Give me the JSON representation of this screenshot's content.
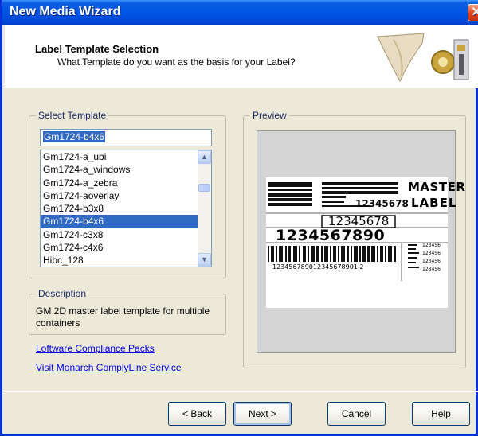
{
  "window": {
    "title": "New Media Wizard",
    "close_glyph": "✕"
  },
  "header": {
    "title": "Label Template Selection",
    "subtitle": "What Template do you want as the basis for your Label?"
  },
  "select_template": {
    "group_label": "Select Template",
    "input_value": "Gm1724-b4x6",
    "items": [
      {
        "label": "Gm1724-a_ubi",
        "selected": false
      },
      {
        "label": "Gm1724-a_windows",
        "selected": false
      },
      {
        "label": "Gm1724-a_zebra",
        "selected": false
      },
      {
        "label": "Gm1724-aoverlay",
        "selected": false
      },
      {
        "label": "Gm1724-b3x8",
        "selected": false
      },
      {
        "label": "Gm1724-b4x6",
        "selected": true
      },
      {
        "label": "Gm1724-c3x8",
        "selected": false
      },
      {
        "label": "Gm1724-c4x6",
        "selected": false
      },
      {
        "label": "Hibc_128",
        "selected": false
      }
    ],
    "scroll_up_glyph": "▲",
    "scroll_down_glyph": "▼"
  },
  "description": {
    "group_label": "Description",
    "text": "GM 2D master label template for multiple containers"
  },
  "links": {
    "compliance": "Loftware Compliance Packs",
    "monarch": "Visit Monarch ComplyLine Service"
  },
  "preview": {
    "group_label": "Preview",
    "label": {
      "master": "MASTER",
      "label_word": "LABEL",
      "small_number": "12345678",
      "mid_number": "12345678",
      "big_number": "1234567890",
      "long_number": "123456789012345678901 2",
      "stack_1": "123456",
      "stack_2": "123456",
      "stack_3": "123456",
      "stack_4": "123456"
    }
  },
  "buttons": {
    "back": "< Back",
    "next": "Next >",
    "cancel": "Cancel",
    "help": "Help"
  },
  "colors": {
    "titlebar": "#0055e5",
    "selection": "#316ac5",
    "link": "#0000ee",
    "dialog_bg": "#ece9d8"
  }
}
